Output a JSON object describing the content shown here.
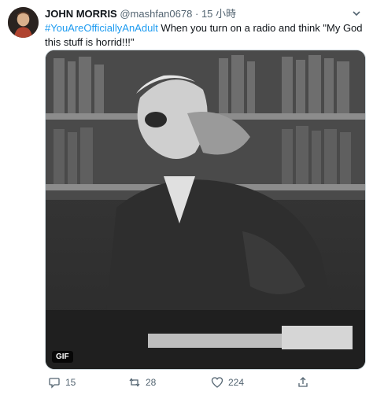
{
  "tweet": {
    "author_name": "JOHN MORRIS",
    "author_handle": "@mashfan0678",
    "separator": "·",
    "time": "15 小時",
    "hashtag": "#YouAreOfficiallyAnAdult",
    "body": " When you turn on a radio and think \"My God this stuff is horrid!!!\"",
    "media_badge": "GIF",
    "reply_count": "15",
    "retweet_count": "28",
    "like_count": "224"
  },
  "icons": {
    "reply": "reply-icon",
    "retweet": "retweet-icon",
    "like": "heart-icon",
    "share": "share-icon",
    "more": "chevron-down-icon"
  },
  "colors": {
    "link": "#1d9bf0",
    "secondary_text": "#536471",
    "primary_text": "#0f1419"
  }
}
